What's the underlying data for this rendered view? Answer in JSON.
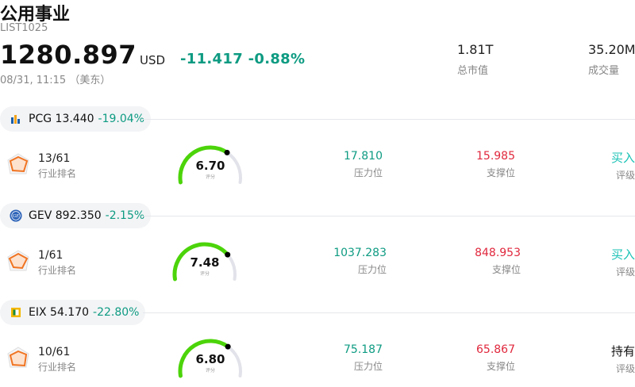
{
  "header": {
    "title": "公用事业",
    "code": "LIST1025",
    "price": "1280.897",
    "currency": "USD",
    "change": "-11.417",
    "change_pct": "-0.88%",
    "time": "08/31, 11:15 （美东）",
    "market_cap": {
      "value": "1.81T",
      "label": "总市值"
    },
    "volume": {
      "value": "35.20M",
      "label": "成交量"
    }
  },
  "labels": {
    "rank": "行业排名",
    "resistance": "压力位",
    "support": "支撑位",
    "rating": "评级",
    "score": "评分"
  },
  "stocks": [
    {
      "ticker": "PCG",
      "price": "13.440",
      "pct": "-19.04%",
      "logo": "pcg-logo",
      "rank": "13/61",
      "score": "6.70",
      "score_fraction": 0.67,
      "resistance": "17.810",
      "support": "15.985",
      "rating": "买入"
    },
    {
      "ticker": "GEV",
      "price": "892.350",
      "pct": "-2.15%",
      "logo": "ge-logo",
      "rank": "1/61",
      "score": "7.48",
      "score_fraction": 0.748,
      "resistance": "1037.283",
      "support": "848.953",
      "rating": "买入"
    },
    {
      "ticker": "EIX",
      "price": "54.170",
      "pct": "-22.80%",
      "logo": "eix-logo",
      "rank": "10/61",
      "score": "6.80",
      "score_fraction": 0.68,
      "resistance": "75.187",
      "support": "65.867",
      "rating": "持有"
    }
  ],
  "colors": {
    "up_green": "#0e9b82",
    "support_red": "#e0283d",
    "buy": "#19c2b5",
    "gauge_fill": "#4cd40a",
    "gauge_track": "#e2e3ea",
    "rank_icon": "#f07422"
  }
}
